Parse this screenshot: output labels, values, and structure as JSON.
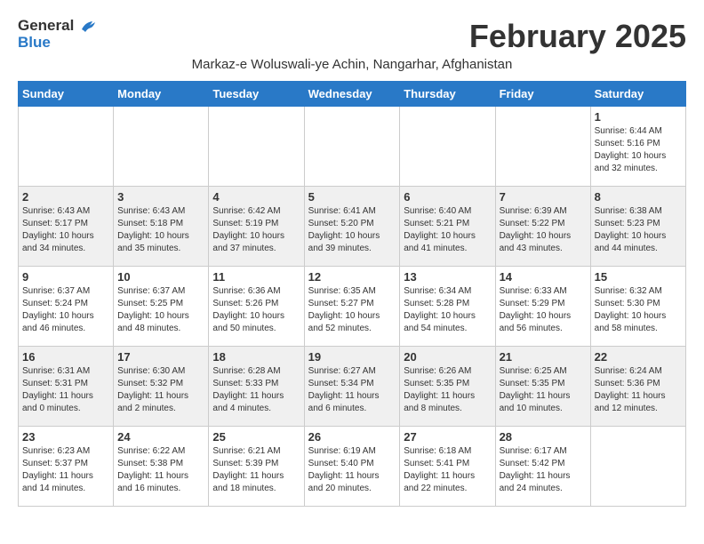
{
  "header": {
    "logo_line1": "General",
    "logo_line2": "Blue",
    "month_title": "February 2025",
    "location": "Markaz-e Woluswali-ye Achin, Nangarhar, Afghanistan"
  },
  "weekdays": [
    "Sunday",
    "Monday",
    "Tuesday",
    "Wednesday",
    "Thursday",
    "Friday",
    "Saturday"
  ],
  "weeks": [
    {
      "shaded": false,
      "days": [
        {
          "num": "",
          "info": ""
        },
        {
          "num": "",
          "info": ""
        },
        {
          "num": "",
          "info": ""
        },
        {
          "num": "",
          "info": ""
        },
        {
          "num": "",
          "info": ""
        },
        {
          "num": "",
          "info": ""
        },
        {
          "num": "1",
          "info": "Sunrise: 6:44 AM\nSunset: 5:16 PM\nDaylight: 10 hours\nand 32 minutes."
        }
      ]
    },
    {
      "shaded": true,
      "days": [
        {
          "num": "2",
          "info": "Sunrise: 6:43 AM\nSunset: 5:17 PM\nDaylight: 10 hours\nand 34 minutes."
        },
        {
          "num": "3",
          "info": "Sunrise: 6:43 AM\nSunset: 5:18 PM\nDaylight: 10 hours\nand 35 minutes."
        },
        {
          "num": "4",
          "info": "Sunrise: 6:42 AM\nSunset: 5:19 PM\nDaylight: 10 hours\nand 37 minutes."
        },
        {
          "num": "5",
          "info": "Sunrise: 6:41 AM\nSunset: 5:20 PM\nDaylight: 10 hours\nand 39 minutes."
        },
        {
          "num": "6",
          "info": "Sunrise: 6:40 AM\nSunset: 5:21 PM\nDaylight: 10 hours\nand 41 minutes."
        },
        {
          "num": "7",
          "info": "Sunrise: 6:39 AM\nSunset: 5:22 PM\nDaylight: 10 hours\nand 43 minutes."
        },
        {
          "num": "8",
          "info": "Sunrise: 6:38 AM\nSunset: 5:23 PM\nDaylight: 10 hours\nand 44 minutes."
        }
      ]
    },
    {
      "shaded": false,
      "days": [
        {
          "num": "9",
          "info": "Sunrise: 6:37 AM\nSunset: 5:24 PM\nDaylight: 10 hours\nand 46 minutes."
        },
        {
          "num": "10",
          "info": "Sunrise: 6:37 AM\nSunset: 5:25 PM\nDaylight: 10 hours\nand 48 minutes."
        },
        {
          "num": "11",
          "info": "Sunrise: 6:36 AM\nSunset: 5:26 PM\nDaylight: 10 hours\nand 50 minutes."
        },
        {
          "num": "12",
          "info": "Sunrise: 6:35 AM\nSunset: 5:27 PM\nDaylight: 10 hours\nand 52 minutes."
        },
        {
          "num": "13",
          "info": "Sunrise: 6:34 AM\nSunset: 5:28 PM\nDaylight: 10 hours\nand 54 minutes."
        },
        {
          "num": "14",
          "info": "Sunrise: 6:33 AM\nSunset: 5:29 PM\nDaylight: 10 hours\nand 56 minutes."
        },
        {
          "num": "15",
          "info": "Sunrise: 6:32 AM\nSunset: 5:30 PM\nDaylight: 10 hours\nand 58 minutes."
        }
      ]
    },
    {
      "shaded": true,
      "days": [
        {
          "num": "16",
          "info": "Sunrise: 6:31 AM\nSunset: 5:31 PM\nDaylight: 11 hours\nand 0 minutes."
        },
        {
          "num": "17",
          "info": "Sunrise: 6:30 AM\nSunset: 5:32 PM\nDaylight: 11 hours\nand 2 minutes."
        },
        {
          "num": "18",
          "info": "Sunrise: 6:28 AM\nSunset: 5:33 PM\nDaylight: 11 hours\nand 4 minutes."
        },
        {
          "num": "19",
          "info": "Sunrise: 6:27 AM\nSunset: 5:34 PM\nDaylight: 11 hours\nand 6 minutes."
        },
        {
          "num": "20",
          "info": "Sunrise: 6:26 AM\nSunset: 5:35 PM\nDaylight: 11 hours\nand 8 minutes."
        },
        {
          "num": "21",
          "info": "Sunrise: 6:25 AM\nSunset: 5:35 PM\nDaylight: 11 hours\nand 10 minutes."
        },
        {
          "num": "22",
          "info": "Sunrise: 6:24 AM\nSunset: 5:36 PM\nDaylight: 11 hours\nand 12 minutes."
        }
      ]
    },
    {
      "shaded": false,
      "days": [
        {
          "num": "23",
          "info": "Sunrise: 6:23 AM\nSunset: 5:37 PM\nDaylight: 11 hours\nand 14 minutes."
        },
        {
          "num": "24",
          "info": "Sunrise: 6:22 AM\nSunset: 5:38 PM\nDaylight: 11 hours\nand 16 minutes."
        },
        {
          "num": "25",
          "info": "Sunrise: 6:21 AM\nSunset: 5:39 PM\nDaylight: 11 hours\nand 18 minutes."
        },
        {
          "num": "26",
          "info": "Sunrise: 6:19 AM\nSunset: 5:40 PM\nDaylight: 11 hours\nand 20 minutes."
        },
        {
          "num": "27",
          "info": "Sunrise: 6:18 AM\nSunset: 5:41 PM\nDaylight: 11 hours\nand 22 minutes."
        },
        {
          "num": "28",
          "info": "Sunrise: 6:17 AM\nSunset: 5:42 PM\nDaylight: 11 hours\nand 24 minutes."
        },
        {
          "num": "",
          "info": ""
        }
      ]
    }
  ]
}
